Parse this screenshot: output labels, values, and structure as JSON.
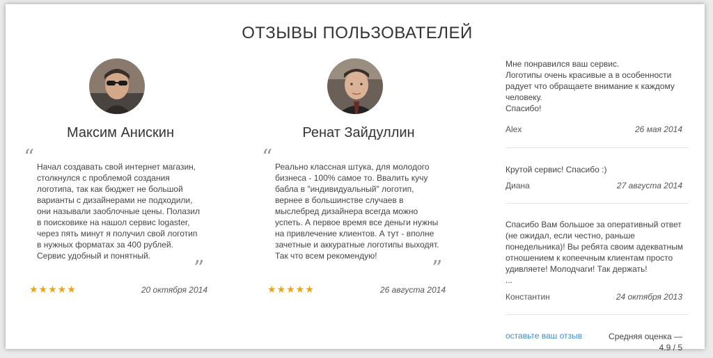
{
  "page": {
    "title": "ОТЗЫВЫ ПОЛЬЗОВАТЕЛЕЙ"
  },
  "featured": [
    {
      "name": "Максим Анискин",
      "text": "Начал создавать свой интернет магазин, столкнулся с проблемой создания логотипа, так как бюджет не большой варианты с дизайнерами не подходили, они называли заоблочные цены. Полазил в поисковике на нашол сервис logaster, через пять минут я получил свой логотип в нужных форматах за 400 рублей. Сервис удобный и понятный.",
      "rating": 5,
      "stars": "★★★★★",
      "date": "20 октября 2014",
      "quote_open": "“",
      "quote_close": "”"
    },
    {
      "name": "Ренат Зайдуллин",
      "text": "Реально классная штука, для молодого бизнеса - 100% самое то. Ввалить кучу бабла в \"индивидуальный\" логотип, вернее в большинстве случаев в мыслебред дизайнера всегда можно успеть. А первое время все деньги нужны на привлечение клиентов. А тут - вполне зачетные и аккуратные логотипы выходят. Так что всем рекомендую!",
      "rating": 5,
      "stars": "★★★★★",
      "date": "26 августа 2014",
      "quote_open": "“",
      "quote_close": "”"
    }
  ],
  "side_reviews": [
    {
      "lines": [
        "Мне понравился ваш сервис.",
        "Логотипы очень красивые а в особенности радует что обращаете внимание к каждому человеку.",
        "Спасибо!"
      ],
      "author": "Alex",
      "date": "26 мая 2014"
    },
    {
      "lines": [
        "Крутой сервис! Спасибо :)"
      ],
      "author": "Диана",
      "date": "27 августа 2014"
    },
    {
      "lines": [
        "Спасибо Вам большое за оперативный ответ (не ожидал, если честно, раньше понедельника)! Вы ребята своим адекватным отношением к копеечным клиентам просто удивляете! Молодчаги! Так держать!",
        "..."
      ],
      "author": "Константин",
      "date": "24 октября 2013"
    }
  ],
  "footer": {
    "leave_review": "оставьте ваш отзыв",
    "avg_label": "Средняя оценка —",
    "avg_value": "4.9 / 5"
  },
  "colors": {
    "accent_link": "#3a8fd0",
    "star": "#f0a30a",
    "panel_bg": "#ffffff"
  }
}
